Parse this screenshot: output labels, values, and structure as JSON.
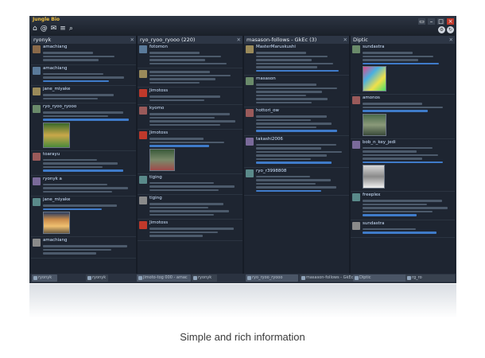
{
  "app": {
    "logo_text": "Jungle Bio",
    "toolbar_icons": [
      "home-icon",
      "at-icon",
      "mail-icon",
      "list-icon",
      "search-icon"
    ],
    "columns": [
      {
        "title": "ryonyk",
        "icon": "home-icon"
      },
      {
        "title": "ryo_ryoo_ryooo (220)",
        "icon": "home-icon"
      },
      {
        "title": "masason-follows - GkEc (3)",
        "icon": "list-icon"
      },
      {
        "title": "Diptic",
        "icon": "search-icon"
      }
    ],
    "col1_users": [
      "amachiang",
      "amachiang",
      "jane_miyake",
      "ryo_ryoo_ryooo",
      "toarayu",
      "ryonyk a",
      "jane_miyake",
      "amachiang"
    ],
    "col2_users": [
      "fotomon",
      "",
      "Jimotoss",
      "kyomo",
      "Jimotoss",
      "tiging",
      "tiging",
      "Jimotoss"
    ],
    "col3_users": [
      "MasterMaruskushi",
      "masason",
      "hottori_ow",
      "takashi2006",
      "ryo_r3998808"
    ],
    "col4_users": [
      "sundastra",
      "amonos",
      "bob_n_key_jedi",
      "freeplex"
    ],
    "statusbar_tabs": [
      "ryonyk",
      "ryonyk",
      "jimoto-tog 000 - amac",
      "ryonyk",
      "ryo_ryoo_ryooo",
      "masason-follows - GkEc",
      "Diptic",
      "rg_ro"
    ]
  },
  "caption": "Simple and rich information",
  "colors": {
    "window_bg": "#161c26",
    "column_bg": "#1e2531",
    "header_bg": "#2d3645",
    "link": "#3f7bc9",
    "close": "#c0392b"
  }
}
